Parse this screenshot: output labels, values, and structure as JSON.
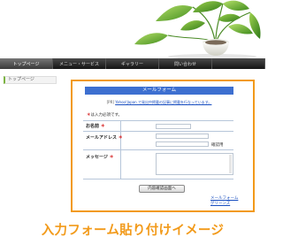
{
  "nav": {
    "items": [
      "トップページ",
      "メニュー・サービス",
      "ギャラリー",
      "問い合わせ",
      ""
    ]
  },
  "sidebar": {
    "item": "トップページ"
  },
  "form": {
    "title": "メールフォーム",
    "notice_tag": "[PR]",
    "notice_text": "Yahoo!Japan で発出中掲載の記事に掲載を行なっています。",
    "required_note": "は入力必須です。",
    "required_mark": "＊",
    "fields": {
      "name_label": "お名前",
      "email_label": "メールアドレス",
      "email_confirm_label": "確認用",
      "message_label": "メッセージ"
    },
    "submit_label": "内容確認画面へ",
    "footer_links": [
      "メールフォーム",
      "グリーンズ"
    ]
  },
  "caption": "入力フォーム貼り付けイメージ",
  "colors": {
    "accent": "#f29a1a",
    "form_header": "#3d6fd0",
    "nav": "#1f1f1f"
  }
}
